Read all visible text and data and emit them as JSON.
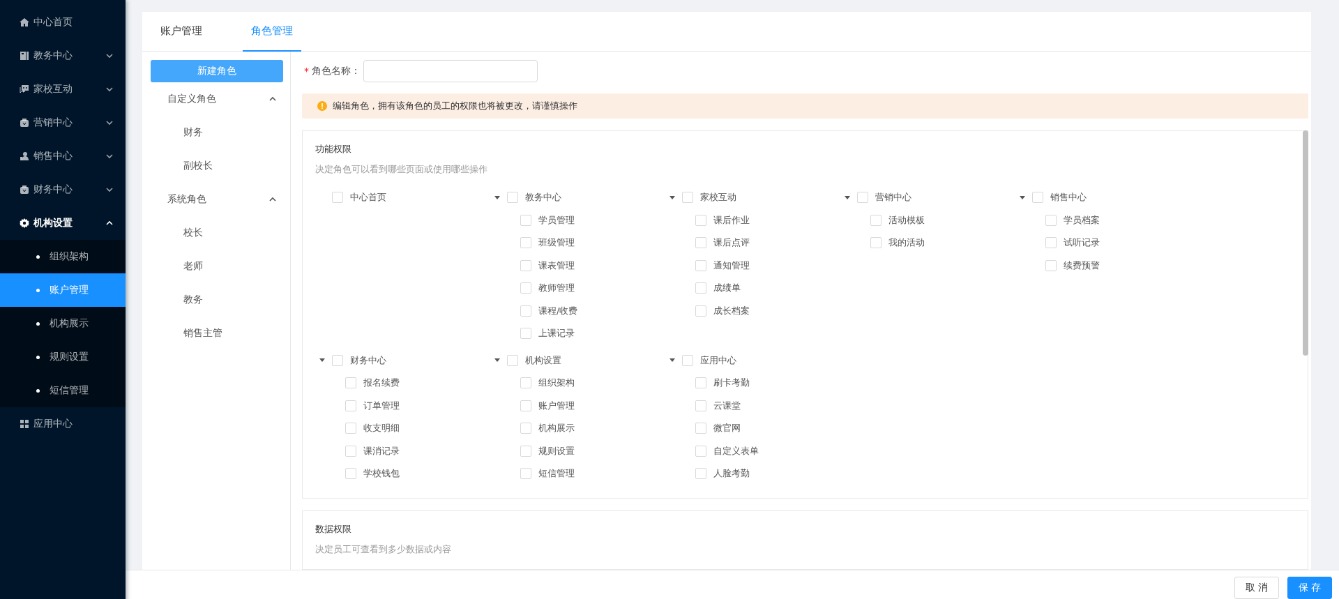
{
  "sidebar": {
    "items": [
      {
        "label": "中心首页",
        "kind": "link",
        "selected": false
      },
      {
        "label": "教务中心",
        "kind": "menu",
        "expanded": false
      },
      {
        "label": "家校互动",
        "kind": "menu",
        "expanded": false
      },
      {
        "label": "营销中心",
        "kind": "menu",
        "expanded": false
      },
      {
        "label": "销售中心",
        "kind": "menu",
        "expanded": false
      },
      {
        "label": "财务中心",
        "kind": "menu",
        "expanded": false
      },
      {
        "label": "机构设置",
        "kind": "menu",
        "expanded": true,
        "children": [
          {
            "label": "组织架构",
            "selected": false
          },
          {
            "label": "账户管理",
            "selected": true
          },
          {
            "label": "机构展示",
            "selected": false
          },
          {
            "label": "规则设置",
            "selected": false
          },
          {
            "label": "短信管理",
            "selected": false
          }
        ]
      },
      {
        "label": "应用中心",
        "kind": "link",
        "selected": false
      }
    ]
  },
  "tabs": [
    {
      "label": "账户管理",
      "selected": false
    },
    {
      "label": "角色管理",
      "selected": true
    }
  ],
  "roles": {
    "new_button": "新建角色",
    "groups": [
      {
        "label": "自定义角色",
        "expanded": true,
        "items": [
          {
            "label": "财务",
            "selected": false
          },
          {
            "label": "副校长",
            "selected": false
          }
        ]
      },
      {
        "label": "系统角色",
        "expanded": true,
        "items": [
          {
            "label": "校长",
            "selected": false
          },
          {
            "label": "老师",
            "selected": false
          },
          {
            "label": "教务",
            "selected": false
          },
          {
            "label": "销售主管",
            "selected": false
          }
        ]
      }
    ]
  },
  "form": {
    "role_name": {
      "required_mark": "*",
      "label": "角色名称："
    }
  },
  "alert": {
    "kind": "warning",
    "text": "编辑角色，拥有该角色的员工的权限也将被更改，请谨慎操作"
  },
  "sections": [
    {
      "title": "功能权限",
      "description": "决定角色可以看到哪些页面或使用哪些操作",
      "groups": [
        {
          "label": "中心首页",
          "checked": false
        },
        {
          "label": "教务中心",
          "checked": false,
          "expanded": true,
          "children": [
            {
              "label": "学员管理",
              "checked": false
            },
            {
              "label": "班级管理",
              "checked": false
            },
            {
              "label": "课表管理",
              "checked": false
            },
            {
              "label": "教师管理",
              "checked": false
            },
            {
              "label": "课程/收费",
              "checked": false
            },
            {
              "label": "上课记录",
              "checked": false
            }
          ]
        },
        {
          "label": "家校互动",
          "checked": false,
          "expanded": true,
          "children": [
            {
              "label": "课后作业",
              "checked": false
            },
            {
              "label": "课后点评",
              "checked": false
            },
            {
              "label": "通知管理",
              "checked": false
            },
            {
              "label": "成绩单",
              "checked": false
            },
            {
              "label": "成长档案",
              "checked": false
            }
          ]
        },
        {
          "label": "营销中心",
          "checked": false,
          "expanded": true,
          "children": [
            {
              "label": "活动模板",
              "checked": false
            },
            {
              "label": "我的活动",
              "checked": false
            }
          ]
        },
        {
          "label": "销售中心",
          "checked": false,
          "expanded": true,
          "children": [
            {
              "label": "学员档案",
              "checked": false
            },
            {
              "label": "试听记录",
              "checked": false
            },
            {
              "label": "续费预警",
              "checked": false
            }
          ]
        },
        {
          "label": "财务中心",
          "checked": false,
          "expanded": true,
          "children": [
            {
              "label": "报名续费",
              "checked": false
            },
            {
              "label": "订单管理",
              "checked": false
            },
            {
              "label": "收支明细",
              "checked": false
            },
            {
              "label": "课消记录",
              "checked": false
            },
            {
              "label": "学校钱包",
              "checked": false
            }
          ]
        },
        {
          "label": "机构设置",
          "checked": false,
          "expanded": true,
          "children": [
            {
              "label": "组织架构",
              "checked": false
            },
            {
              "label": "账户管理",
              "checked": false
            },
            {
              "label": "机构展示",
              "checked": false
            },
            {
              "label": "规则设置",
              "checked": false
            },
            {
              "label": "短信管理",
              "checked": false
            }
          ]
        },
        {
          "label": "应用中心",
          "checked": false,
          "expanded": true,
          "children": [
            {
              "label": "刷卡考勤",
              "checked": false
            },
            {
              "label": "云课堂",
              "checked": false
            },
            {
              "label": "微官网",
              "checked": false
            },
            {
              "label": "自定义表单",
              "checked": false
            },
            {
              "label": "人脸考勤",
              "checked": false
            }
          ]
        }
      ]
    },
    {
      "title": "数据权限",
      "description": "决定员工可查看到多少数据或内容"
    }
  ],
  "footer": {
    "buttons": [
      {
        "label": "取 消",
        "kind": "default"
      },
      {
        "label": "保 存",
        "kind": "primary"
      }
    ]
  }
}
